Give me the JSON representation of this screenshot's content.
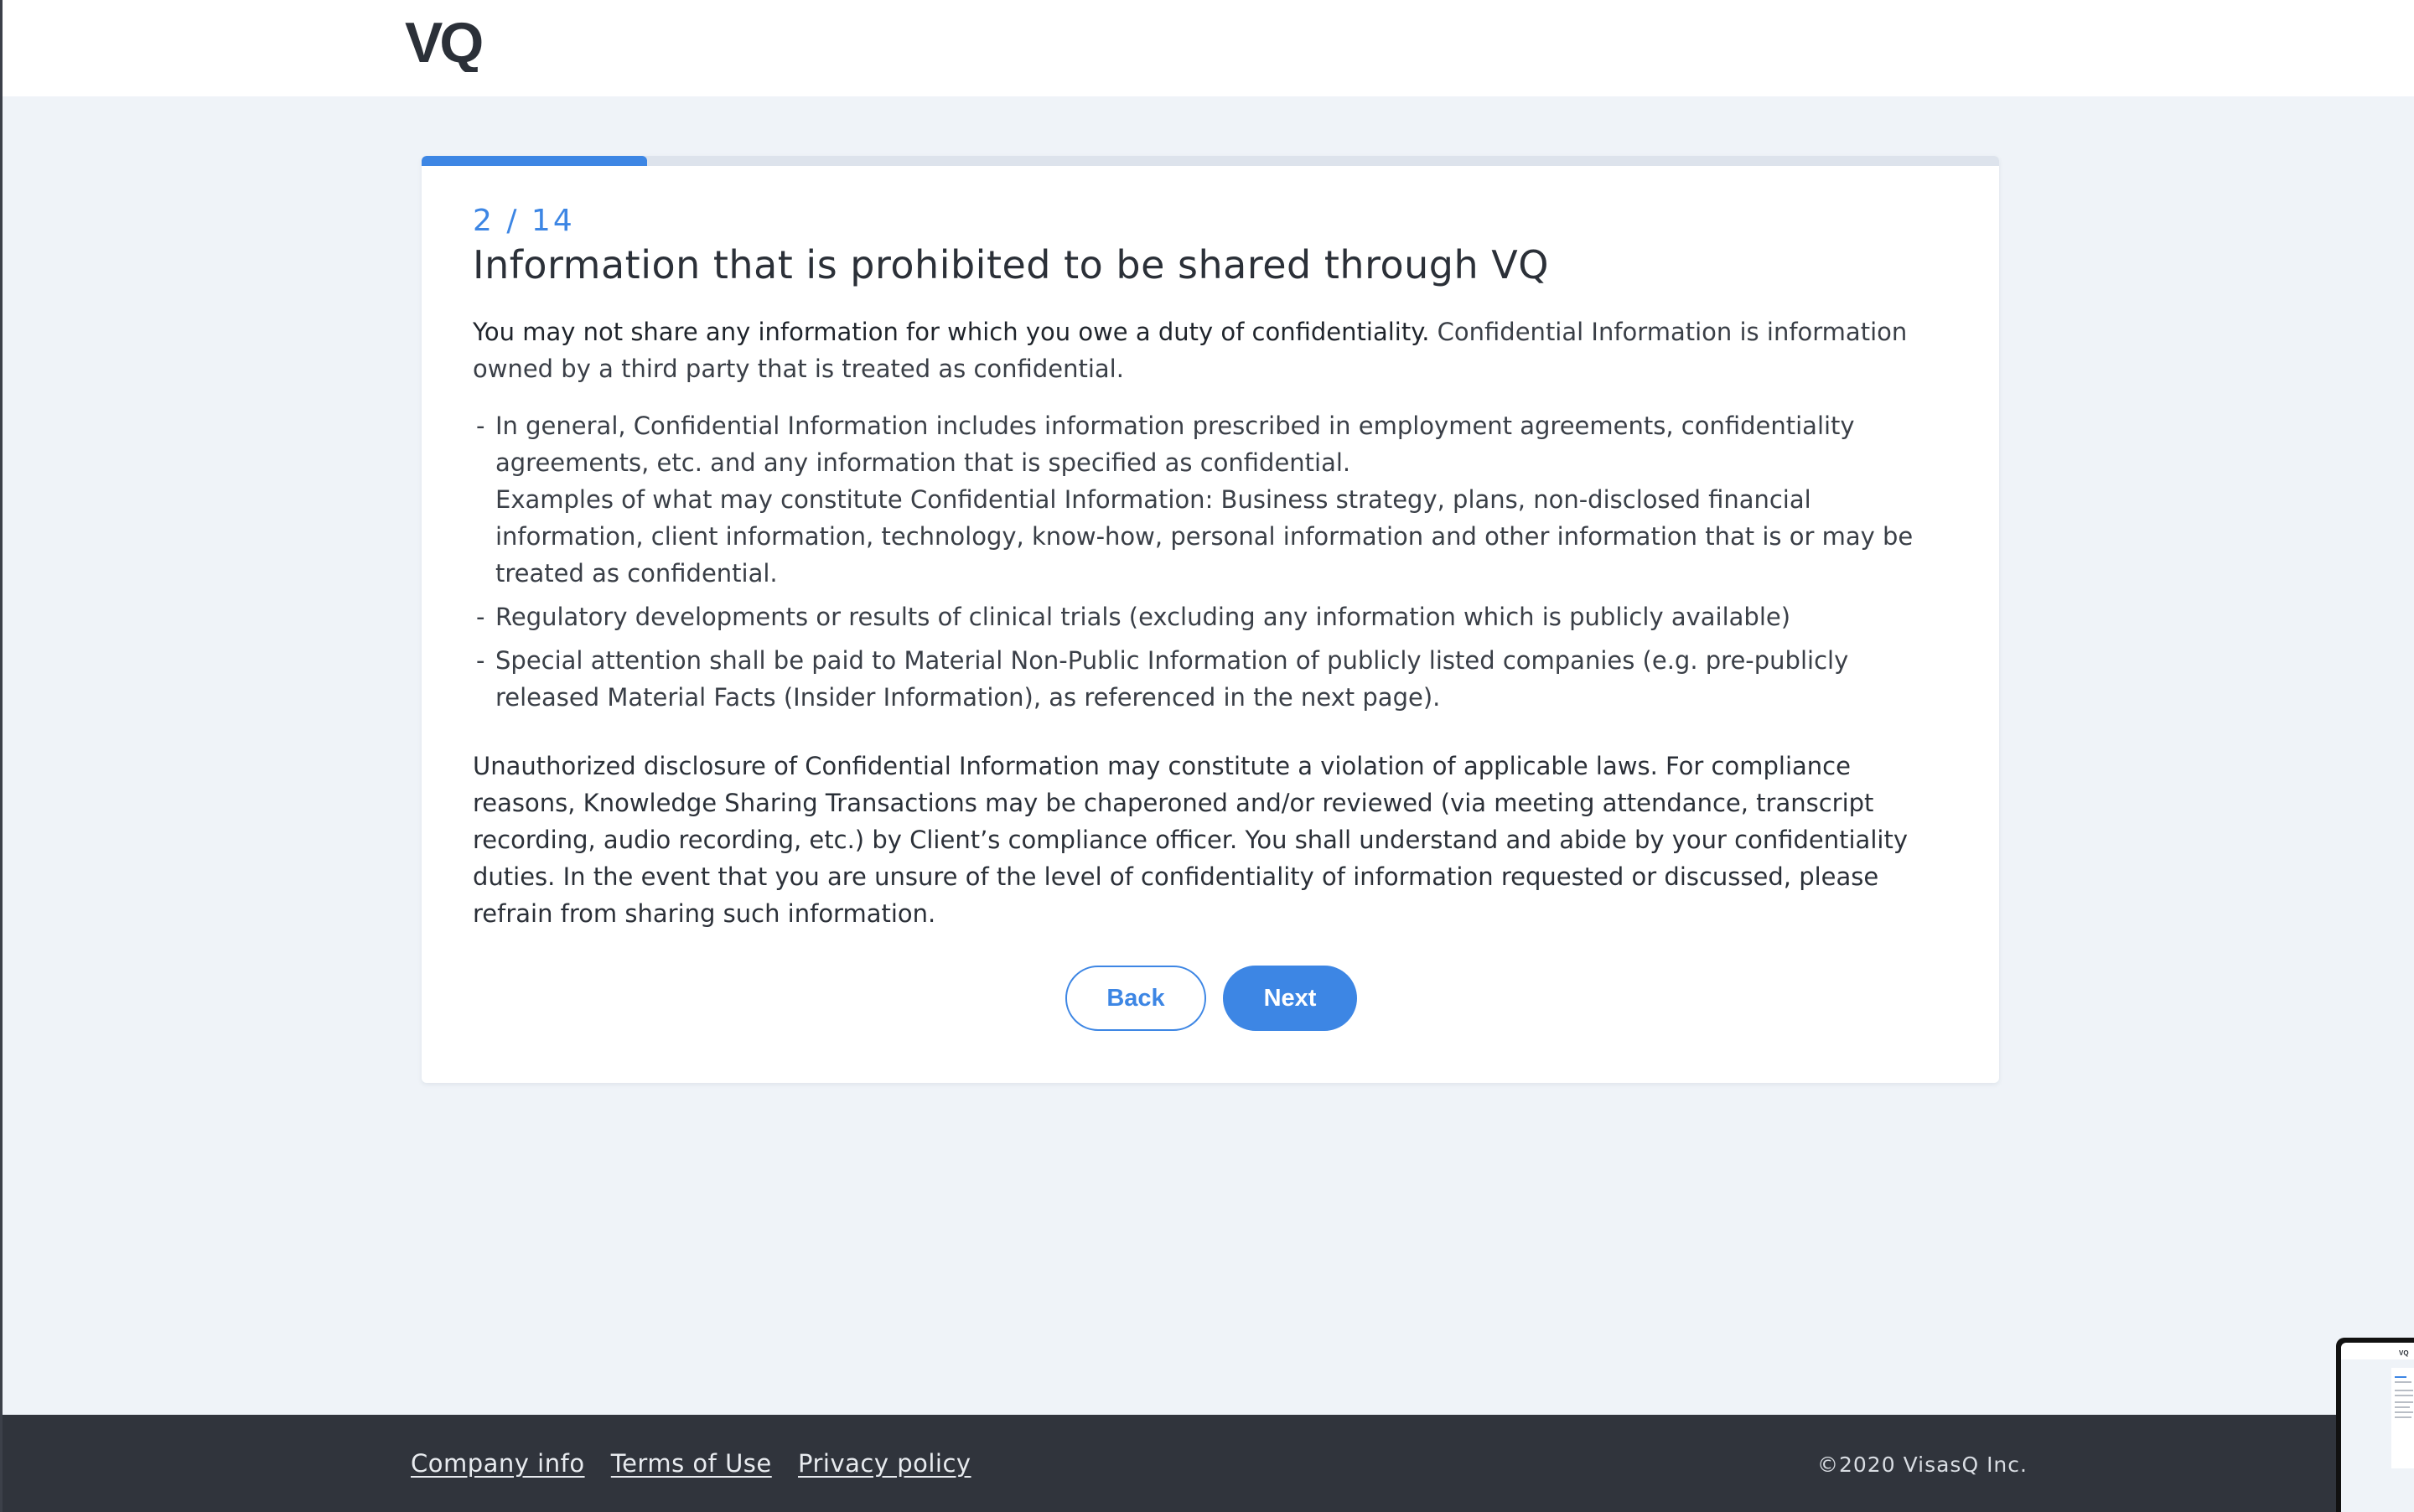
{
  "header": {
    "logo_text": "VQ"
  },
  "progress": {
    "current": 2,
    "total": 14,
    "step_label": "2 / 14",
    "fraction": 0.143,
    "color": "#3d86e4"
  },
  "card": {
    "title": "Information that is prohibited to be shared through VQ",
    "intro_strong": "You may not share any information for which you owe a duty of confidentiality.",
    "intro_rest": " Confidential Information is information owned by a third party that is treated as confidential.",
    "bullets": [
      {
        "text": "In general, Confidential Information includes information prescribed in employment agreements, confidentiality agreements, etc. and any information that is specified as confidential.",
        "subtext": "Examples of what may constitute Confidential Information: Business strategy, plans, non-disclosed financial information, client information, technology, know-how, personal information and other information that is or may be treated as confidential."
      },
      {
        "text": "Regulatory developments or results of clinical trials (excluding any information which is publicly available)"
      },
      {
        "text": "Special attention shall be paid to Material Non-Public Information of publicly listed companies (e.g. pre-publicly released Material Facts (Insider Information), as referenced in the next page)."
      }
    ],
    "closing": "Unauthorized disclosure of Confidential Information may constitute a violation of applicable laws. For compliance reasons, Knowledge Sharing Transactions may be chaperoned and/or reviewed (via meeting attendance, transcript recording, audio recording, etc.) by Client’s compliance officer. You shall understand and abide by your confidentiality duties. In the event that you are unsure of the level of confidentiality of information requested or discussed, please refrain from sharing such information.",
    "back_label": "Back",
    "next_label": "Next"
  },
  "footer": {
    "links": [
      "Company info",
      "Terms of Use",
      "Privacy policy"
    ],
    "copyright": "©2020 VisasQ Inc."
  },
  "thumbnail": {
    "logo_text": "VQ"
  }
}
